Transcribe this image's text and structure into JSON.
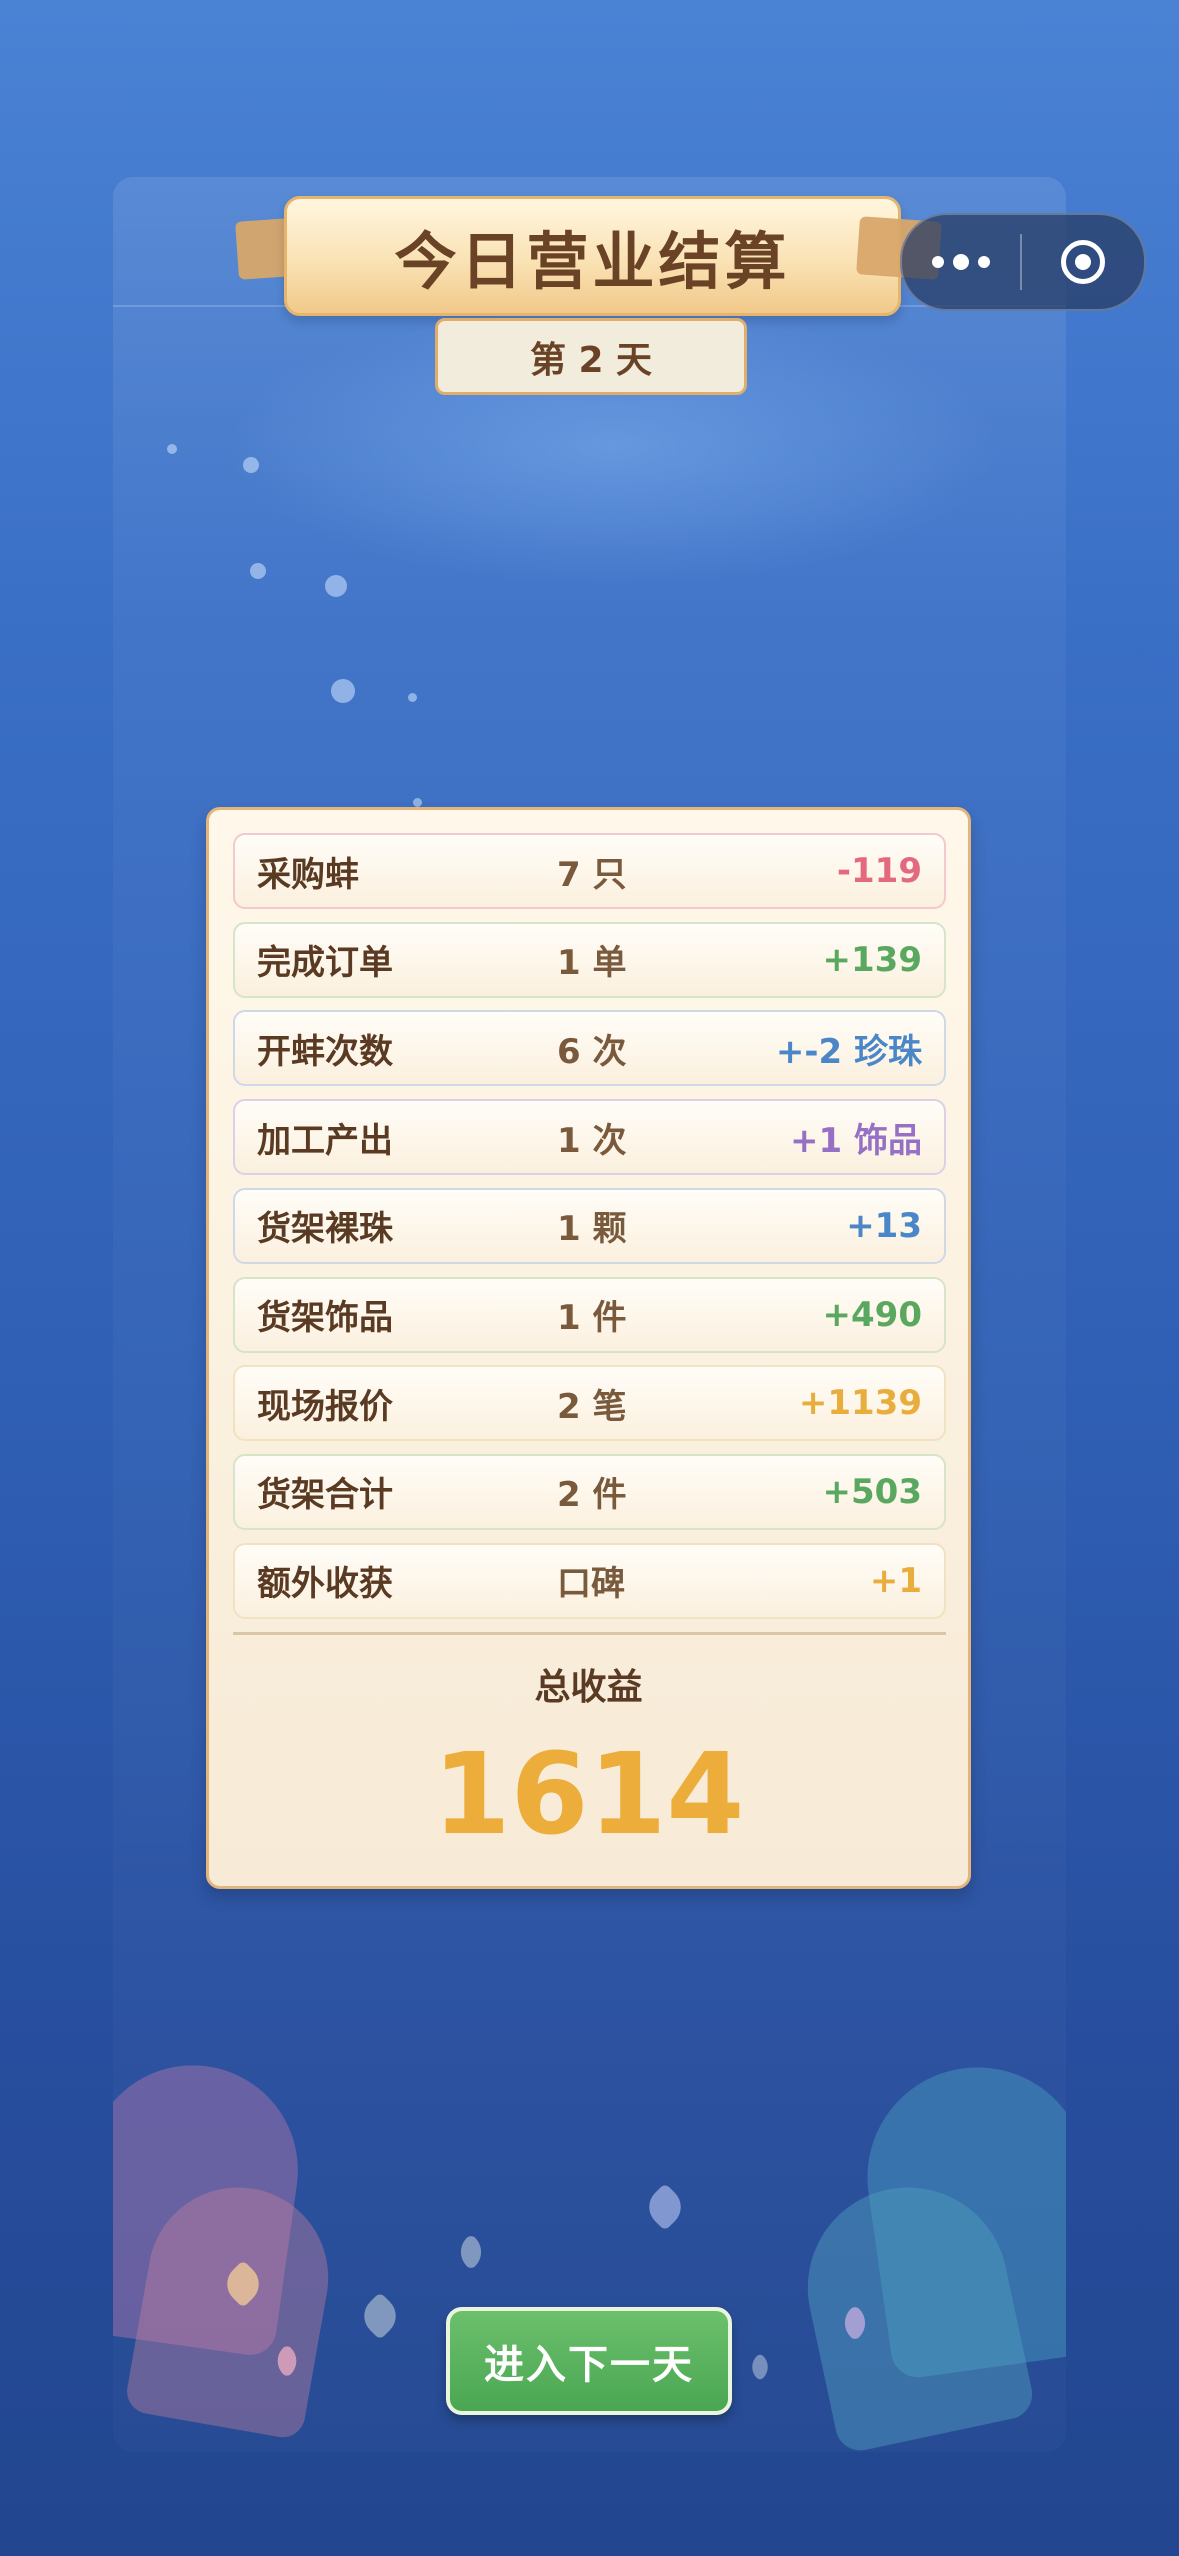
{
  "header": {
    "title": "今日营业结算",
    "day_label": "第 2 天"
  },
  "capsule": {
    "more_icon": "more-dots-icon",
    "close_icon": "target-close-icon"
  },
  "results": [
    {
      "label": "采购蚌",
      "qty": "7 只",
      "value": "-119",
      "color": "#e36a7e"
    },
    {
      "label": "完成订单",
      "qty": "1 单",
      "value": "+139",
      "color": "#5aa860"
    },
    {
      "label": "开蚌次数",
      "qty": "6 次",
      "value": "+-2 珍珠",
      "color": "#4a86c8"
    },
    {
      "label": "加工产出",
      "qty": "1 次",
      "value": "+1 饰品",
      "color": "#9670c4"
    },
    {
      "label": "货架裸珠",
      "qty": "1 颗",
      "value": "+13",
      "color": "#4a86c8"
    },
    {
      "label": "货架饰品",
      "qty": "1 件",
      "value": "+490",
      "color": "#5aa860"
    },
    {
      "label": "现场报价",
      "qty": "2 笔",
      "value": "+1139",
      "color": "#e8ad3c"
    },
    {
      "label": "货架合计",
      "qty": "2 件",
      "value": "+503",
      "color": "#5aa860"
    },
    {
      "label": "额外收获",
      "qty": "口碑",
      "value": "+1",
      "color": "#e8ad3c"
    }
  ],
  "total": {
    "label": "总收益",
    "value": "1614"
  },
  "footer": {
    "next_button_label": "进入下一天"
  },
  "colors": {
    "accent_gold": "#ecad3a",
    "button_green": "#4aa652",
    "title_brown": "#6a4326"
  }
}
